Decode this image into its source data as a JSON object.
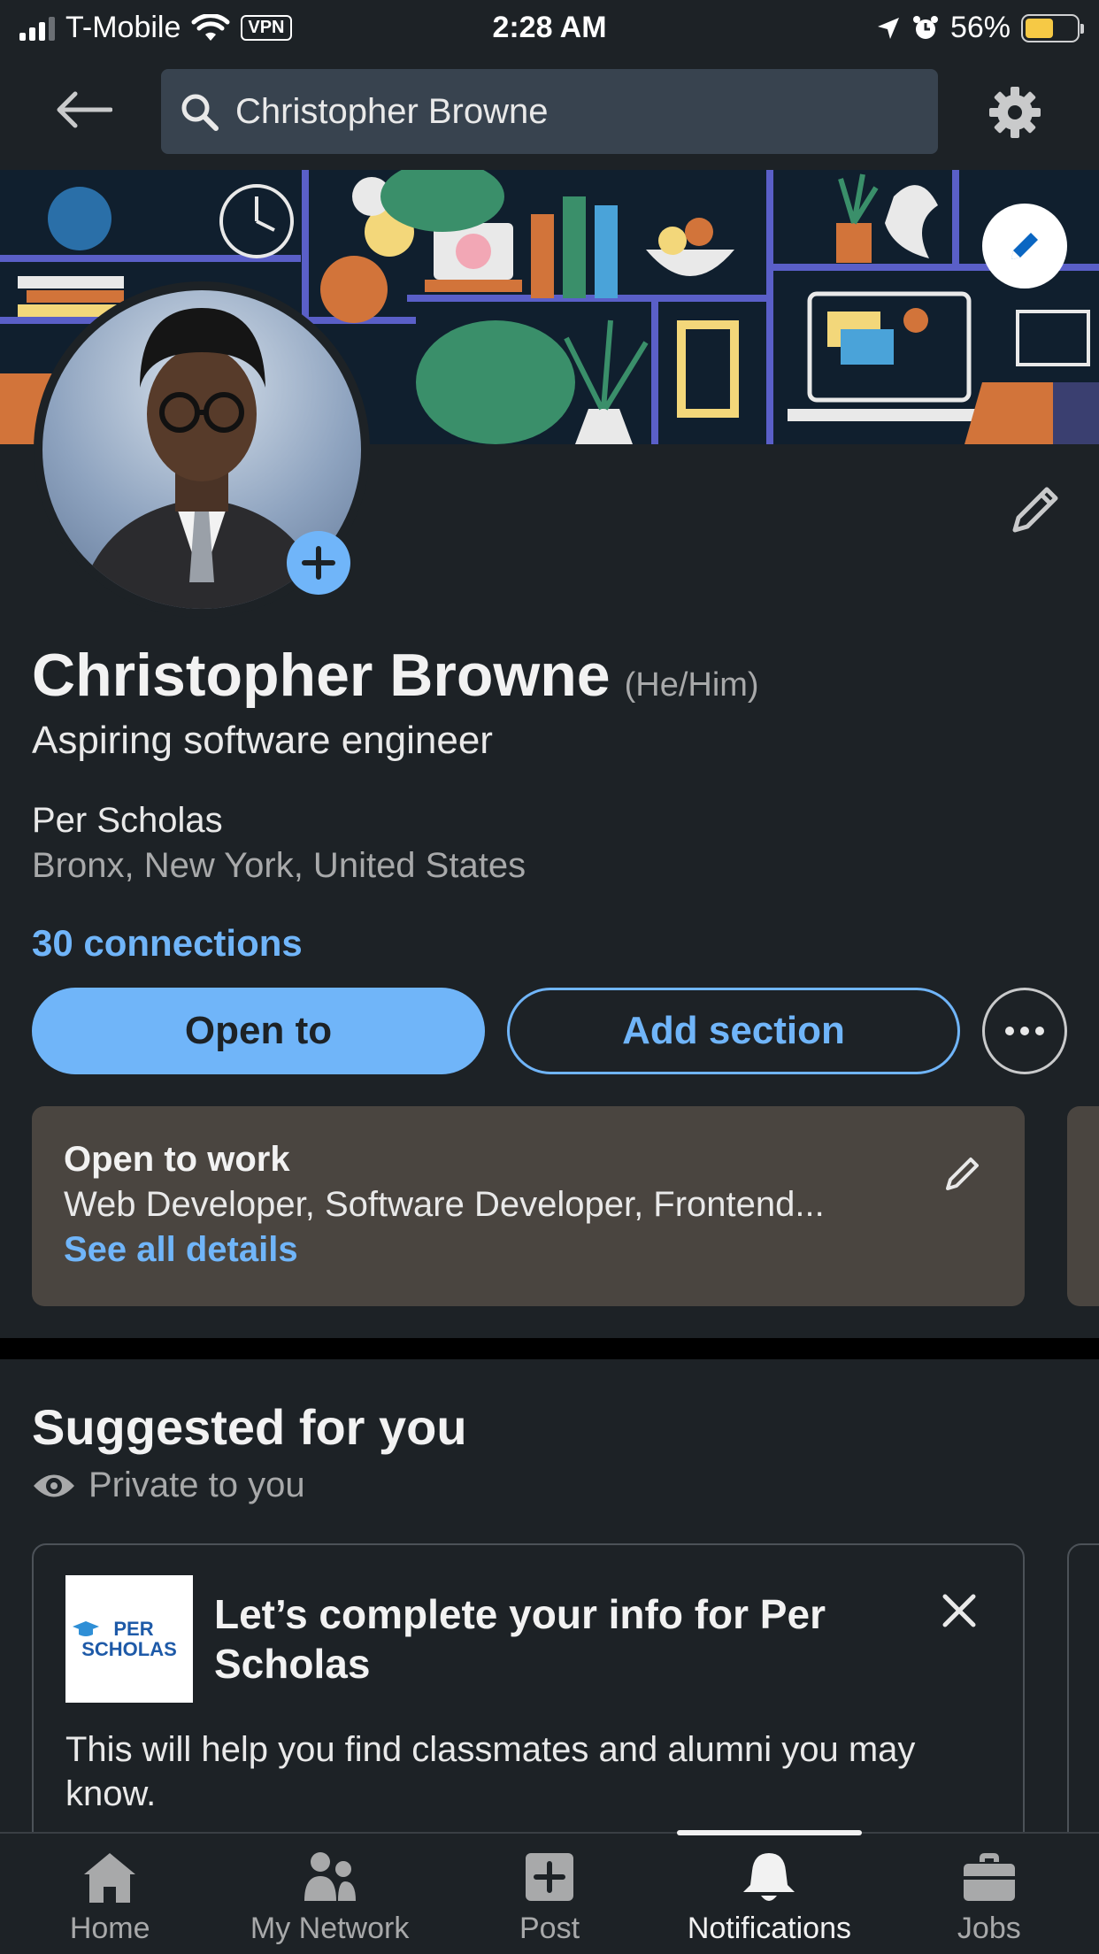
{
  "status_bar": {
    "carrier": "T-Mobile",
    "vpn": "VPN",
    "time": "2:28 AM",
    "battery": "56%",
    "battery_level": 0.56
  },
  "search": {
    "query": "Christopher Browne"
  },
  "profile": {
    "name": "Christopher Browne",
    "pronouns": "(He/Him)",
    "headline": "Aspiring software engineer",
    "organization": "Per Scholas",
    "location": "Bronx, New York, United States",
    "connections": "30 connections"
  },
  "actions": {
    "open_to": "Open to",
    "add_section": "Add section"
  },
  "open_to_work": {
    "title": "Open to work",
    "roles": "Web Developer, Software Developer, Frontend...",
    "link": "See all details"
  },
  "suggested": {
    "title": "Suggested for you",
    "privacy": "Private to you",
    "card": {
      "logo_line1": "PER",
      "logo_line2": "SCHOLAS",
      "heading": "Let’s complete your info for Per Scholas",
      "body": "This will help you find classmates and alumni you may know."
    }
  },
  "bottom_nav": [
    {
      "label": "Home",
      "icon": "home-icon"
    },
    {
      "label": "My Network",
      "icon": "network-icon"
    },
    {
      "label": "Post",
      "icon": "post-icon"
    },
    {
      "label": "Notifications",
      "icon": "bell-icon",
      "active": true
    },
    {
      "label": "Jobs",
      "icon": "briefcase-icon"
    }
  ],
  "colors": {
    "background": "#1d2226",
    "accent": "#70b5f9",
    "card": "#4a4540"
  }
}
